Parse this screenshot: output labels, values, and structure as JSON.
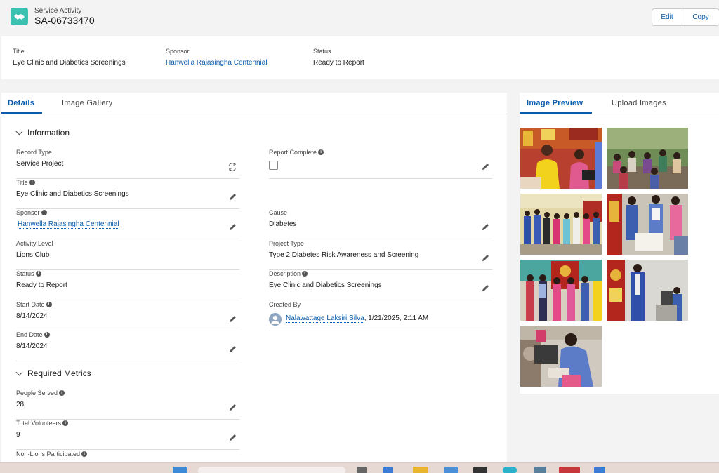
{
  "header": {
    "subtitle": "Service Activity",
    "title": "SA-06733470",
    "edit_label": "Edit",
    "copy_label": "Copy",
    "icon": "handshake-icon"
  },
  "highlights": {
    "title_label": "Title",
    "title_value": "Eye Clinic and Diabetics Screenings",
    "sponsor_label": "Sponsor",
    "sponsor_value": "Hanwella Rajasingha Centennial",
    "status_label": "Status",
    "status_value": "Ready to Report"
  },
  "tabs": {
    "details": "Details",
    "gallery": "Image Gallery"
  },
  "sections": {
    "information": "Information",
    "metrics": "Required Metrics"
  },
  "fields": {
    "record_type": {
      "label": "Record Type",
      "value": "Service Project"
    },
    "title": {
      "label": "Title",
      "value": "Eye Clinic and Diabetics Screenings"
    },
    "sponsor": {
      "label": "Sponsor",
      "value": "Hanwella Rajasingha Centennial"
    },
    "activity_level": {
      "label": "Activity Level",
      "value": "Lions Club"
    },
    "status": {
      "label": "Status",
      "value": "Ready to Report"
    },
    "start_date": {
      "label": "Start Date",
      "value": "8/14/2024"
    },
    "end_date": {
      "label": "End Date",
      "value": "8/14/2024"
    },
    "report_complete": {
      "label": "Report Complete",
      "checked": false
    },
    "cause": {
      "label": "Cause",
      "value": "Diabetes"
    },
    "project_type": {
      "label": "Project Type",
      "value": "Type 2 Diabetes Risk Awareness and Screening"
    },
    "description": {
      "label": "Description",
      "value": "Eye Clinic and Diabetics Screenings"
    },
    "created_by": {
      "label": "Created By",
      "user": "Nalawattage Laksiri Silva",
      "timestamp": ", 1/21/2025, 2:11 AM"
    },
    "people_served": {
      "label": "People Served",
      "value": "28"
    },
    "total_volunteers": {
      "label": "Total Volunteers",
      "value": "9"
    },
    "non_lions": {
      "label": "Non-Lions Participated",
      "value": ""
    }
  },
  "right_tabs": {
    "preview": "Image Preview",
    "upload": "Upload Images"
  },
  "images": [
    {
      "name": "photo-1"
    },
    {
      "name": "photo-2"
    },
    {
      "name": "photo-3"
    },
    {
      "name": "photo-4"
    },
    {
      "name": "photo-5"
    },
    {
      "name": "photo-6"
    },
    {
      "name": "photo-7"
    }
  ],
  "colors": {
    "accent": "#0b5cab",
    "brand_icon": "#3bc1b0"
  }
}
